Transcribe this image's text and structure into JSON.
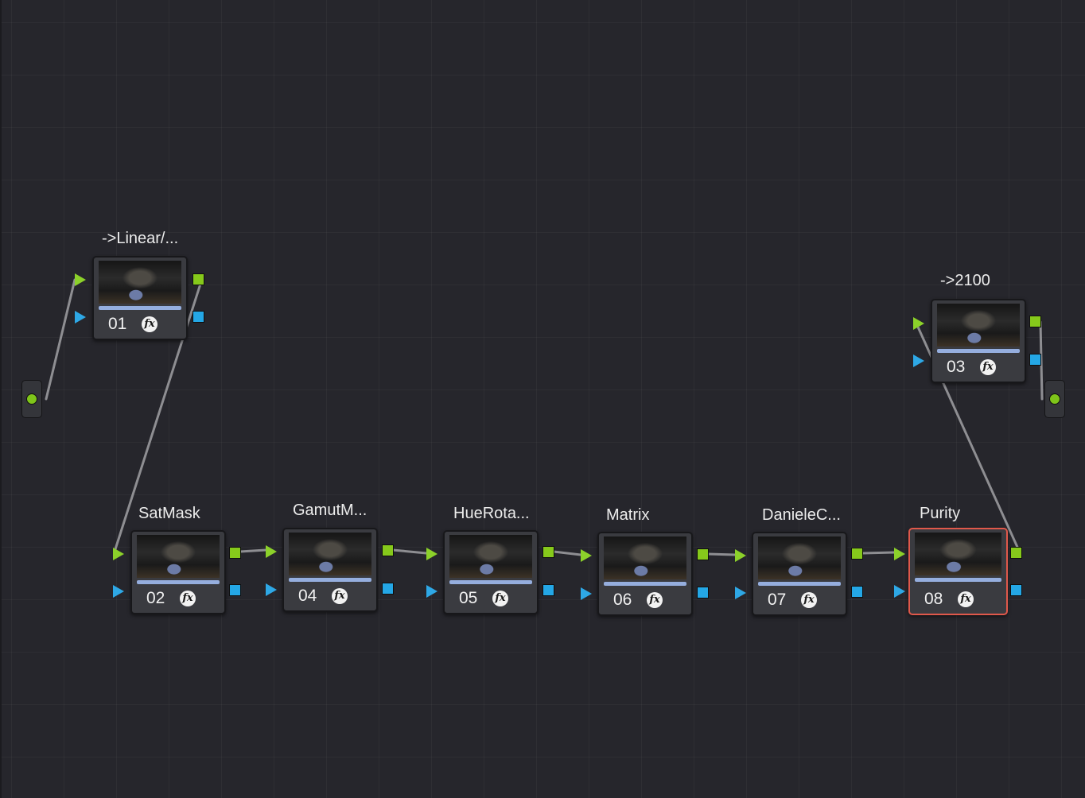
{
  "nodes": [
    {
      "id": "01",
      "label": "->Linear/...",
      "fx": "fx",
      "selected": false
    },
    {
      "id": "02",
      "label": "SatMask",
      "fx": "fx",
      "selected": false
    },
    {
      "id": "04",
      "label": "GamutM...",
      "fx": "fx",
      "selected": false
    },
    {
      "id": "05",
      "label": "HueRota...",
      "fx": "fx",
      "selected": false
    },
    {
      "id": "06",
      "label": "Matrix",
      "fx": "fx",
      "selected": false
    },
    {
      "id": "07",
      "label": "DanieleC...",
      "fx": "fx",
      "selected": false
    },
    {
      "id": "08",
      "label": "Purity",
      "fx": "fx",
      "selected": true
    },
    {
      "id": "03",
      "label": "->2100",
      "fx": "fx",
      "selected": false
    }
  ],
  "colors": {
    "background": "#26262c",
    "rgb_port": "#86c91b",
    "alpha_port": "#24a7e6",
    "selected_outline": "#e0584b",
    "wire": "#8e8e92"
  },
  "icons": {
    "fx_badge": "fx-icon",
    "source_terminal": "source-input-icon",
    "output_terminal": "output-terminal-icon"
  }
}
